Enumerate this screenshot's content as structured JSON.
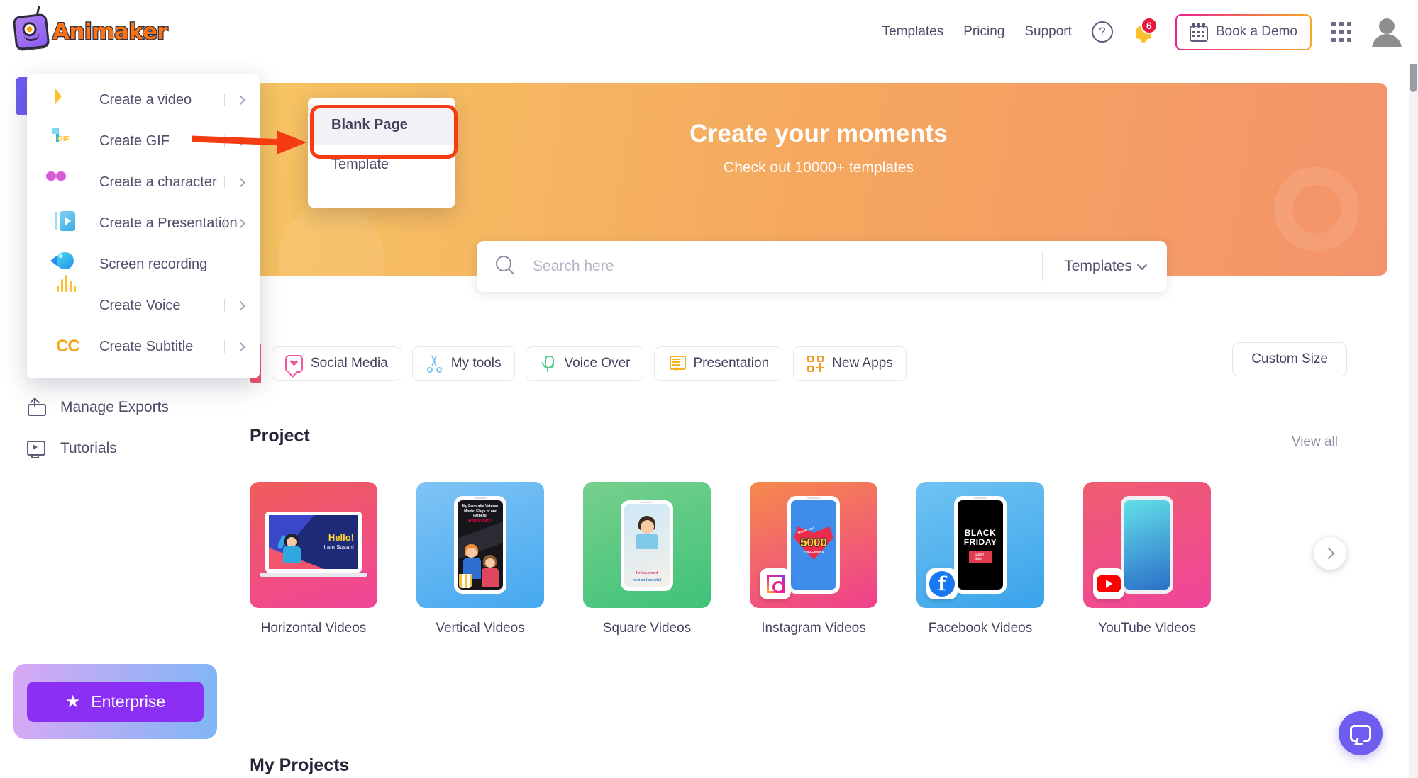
{
  "header": {
    "logo_text": "Animaker",
    "nav": [
      {
        "label": "Templates",
        "name": "nav-templates"
      },
      {
        "label": "Pricing",
        "name": "nav-pricing"
      },
      {
        "label": "Support",
        "name": "nav-support"
      }
    ],
    "help_glyph": "?",
    "notification_count": "6",
    "demo_button": "Book a Demo"
  },
  "banner": {
    "title": "Create your moments",
    "subtitle": "Check out 10000+ templates"
  },
  "search": {
    "placeholder": "Search here",
    "value": "",
    "filter_label": "Templates"
  },
  "filters": [
    {
      "label": "Social Media",
      "icon": "social-media-icon",
      "color": "#f0559e"
    },
    {
      "label": "My tools",
      "icon": "scissors-icon",
      "color": "#7fc4ef"
    },
    {
      "label": "Voice Over",
      "icon": "microphone-icon",
      "color": "#5ec98d"
    },
    {
      "label": "Presentation",
      "icon": "presentation-icon",
      "color": "#f5b519"
    },
    {
      "label": "New Apps",
      "icon": "new-apps-icon",
      "color": "#f59b22"
    }
  ],
  "custom_size_label": "Custom Size",
  "section": {
    "heading": "Project",
    "view_all": "View all",
    "my_projects": "My Projects"
  },
  "cards": [
    {
      "label": "Horizontal Videos",
      "hello": "Hello!",
      "sub": "I am Susan!"
    },
    {
      "label": "Vertical Videos",
      "line1": "My Favourite Veteran Movie: Flags of our Fathers!",
      "line2": "What's yours?"
    },
    {
      "label": "Square Videos",
      "cap1": "Fellow world",
      "cap2": "neat and colorful"
    },
    {
      "label": "Instagram Videos",
      "thanks": "THANK YOU",
      "number": "5000",
      "followers": "FOLLOWERS",
      "badge": "instagram-icon"
    },
    {
      "label": "Facebook Videos",
      "black": "BLACK",
      "friday": "FRIDAY",
      "sale": "Super Sale",
      "badge": "facebook-icon"
    },
    {
      "label": "YouTube Videos",
      "badge": "youtube-icon"
    }
  ],
  "sidebar": {
    "items": [
      {
        "label": "Manage Exports",
        "icon": "export-icon"
      },
      {
        "label": "Tutorials",
        "icon": "tutorial-video-icon"
      }
    ],
    "enterprise_label": "Enterprise"
  },
  "menu": {
    "items": [
      {
        "label": "Create a video",
        "icon": "video-icon",
        "has_arrow": true
      },
      {
        "label": "Create GIF",
        "icon": "gif-icon",
        "has_arrow": true
      },
      {
        "label": "Create a character",
        "icon": "character-icon",
        "has_arrow": true
      },
      {
        "label": "Create a Presentation",
        "icon": "presentation-play-icon",
        "has_arrow": true
      },
      {
        "label": "Screen recording",
        "icon": "camcorder-icon",
        "has_arrow": false
      },
      {
        "label": "Create Voice",
        "icon": "waveform-icon",
        "has_arrow": true
      },
      {
        "label": "Create Subtitle",
        "icon": "cc-icon",
        "has_arrow": true
      }
    ]
  },
  "submenu": {
    "items": [
      {
        "label": "Blank Page",
        "active": true
      },
      {
        "label": "Template",
        "active": false
      }
    ]
  },
  "annotation": {
    "color": "#f53b11"
  }
}
